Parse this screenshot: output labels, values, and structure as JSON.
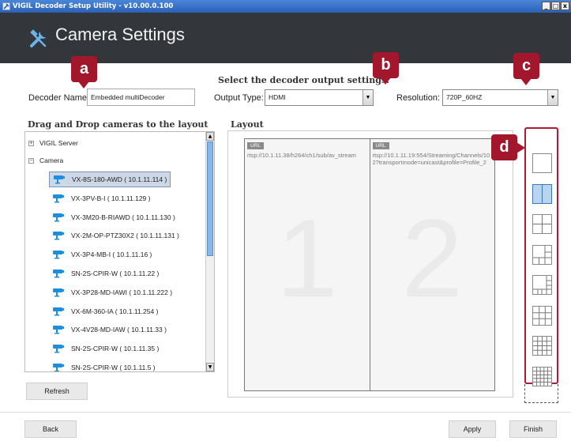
{
  "window": {
    "title": "VIGIL Decoder Setup Utility - v10.00.0.100",
    "controls": [
      "_",
      "□",
      "x"
    ]
  },
  "header": {
    "title": "Camera Settings"
  },
  "callouts": [
    "a",
    "b",
    "c",
    "d"
  ],
  "decoder": {
    "section_title": "Select the decoder output settings.",
    "name_label": "Decoder Name:",
    "name_value": "Embedded multiDecoder",
    "output_type_label": "Output Type:",
    "output_type_value": "HDMI",
    "resolution_label": "Resolution:",
    "resolution_value": "720P_60HZ"
  },
  "cameras_panel": {
    "title": "Drag and Drop cameras to the layout",
    "tree": {
      "server": {
        "expander": "+",
        "label": "VIGIL Server"
      },
      "camera_group": {
        "expander": "−",
        "label": "Camera"
      },
      "items": [
        "VX-8S-180-AWD ( 10.1.11.114 )",
        "VX-3PV-B-I ( 10.1.11.129 )",
        "VX-3M20-B-RIAWD ( 10.1.11.130 )",
        "VX-2M-OP-PTZ30X2 ( 10.1.11.131 )",
        "VX-3P4-MB-I ( 10.1.11.16 )",
        "SN-2S-CPIR-W ( 10.1.11.22 )",
        "VX-3P28-MD-IAWI ( 10.1.11.222 )",
        "VX-6M-360-IA ( 10.1.11.254 )",
        "VX-4V28-MD-IAW ( 10.1.11.33 )",
        "SN-2S-CPIR-W ( 10.1.11.35 )",
        "SN-2S-CPIR-W ( 10.1.11.5 )"
      ],
      "selected_index": 0
    },
    "refresh_label": "Refresh"
  },
  "layout_panel": {
    "title": "Layout",
    "cells": [
      {
        "badge": "URL",
        "url": "rtsp://10.1.11.38/h264/ch1/sub/av_stream",
        "number": "1"
      },
      {
        "badge": "URL",
        "url": "rtsp://10.1.11.19:554/Streaming/Channels/102?transportmode=unicast&profile=Profile_2",
        "number": "2"
      }
    ]
  },
  "layout_options": {
    "selected_index": 1,
    "options": [
      "1x1",
      "1x2",
      "2x2",
      "1+5",
      "1+7",
      "3x3",
      "4x4",
      "5x5"
    ]
  },
  "footer": {
    "back_label": "Back",
    "apply_label": "Apply",
    "finish_label": "Finish"
  },
  "colors": {
    "header_bg": "#33373b",
    "callout": "#a3172c",
    "selection": "#b9d4ec"
  }
}
